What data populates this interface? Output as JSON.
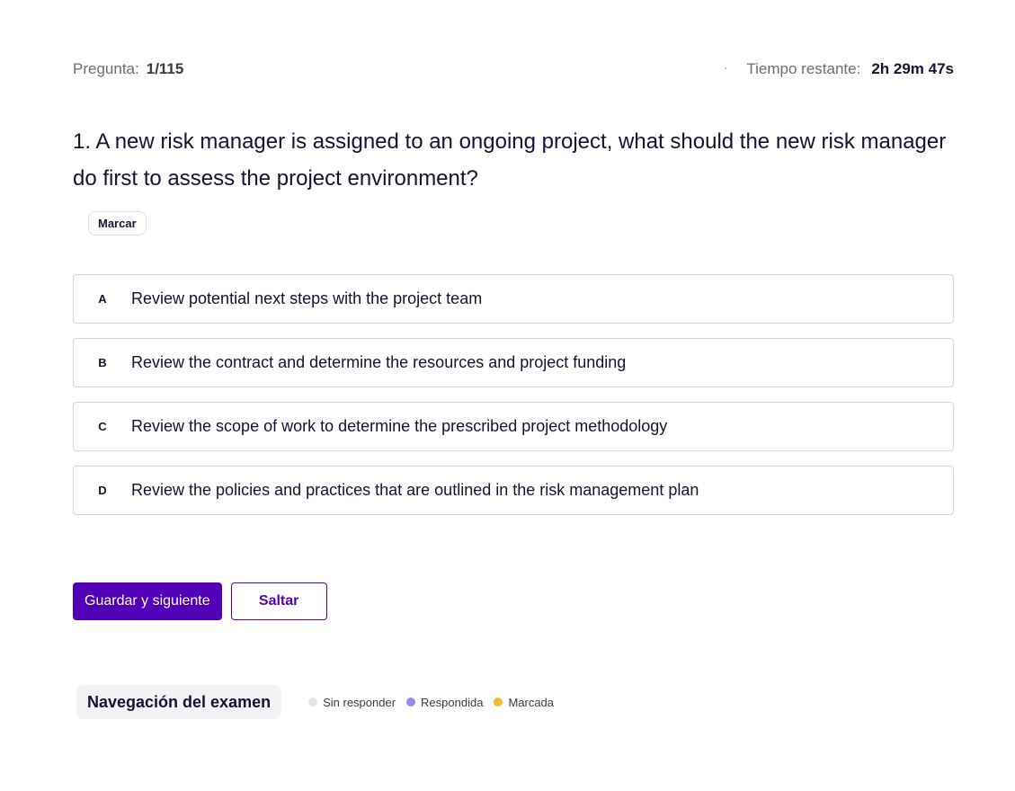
{
  "header": {
    "question_label": "Pregunta:",
    "question_value": "1/115",
    "time_label": "Tiempo restante:",
    "time_value": "2h 29m 47s"
  },
  "question": {
    "text": "1. A new risk manager is assigned to an ongoing project, what should the new risk manager do first to assess the project environment?",
    "mark_label": "Marcar"
  },
  "options": [
    {
      "letter": "A",
      "text": "Review potential next steps with the project team"
    },
    {
      "letter": "B",
      "text": "Review the contract and determine the resources and project funding"
    },
    {
      "letter": "C",
      "text": "Review the scope of work to determine the prescribed project methodology"
    },
    {
      "letter": "D",
      "text": "Review the policies and practices that are outlined in the risk management plan"
    }
  ],
  "actions": {
    "save_next_label": "Guardar y siguiente",
    "skip_label": "Saltar"
  },
  "navigation": {
    "title": "Navegación del examen",
    "legend": [
      {
        "label": "Sin responder",
        "color": "#e4e4e8"
      },
      {
        "label": "Respondida",
        "color": "#9b87f5"
      },
      {
        "label": "Marcada",
        "color": "#f5b82e"
      }
    ]
  },
  "colors": {
    "accent": "#5200b8",
    "text": "#1a1033",
    "muted": "#6b6b7b",
    "border": "#d6d6dc"
  }
}
